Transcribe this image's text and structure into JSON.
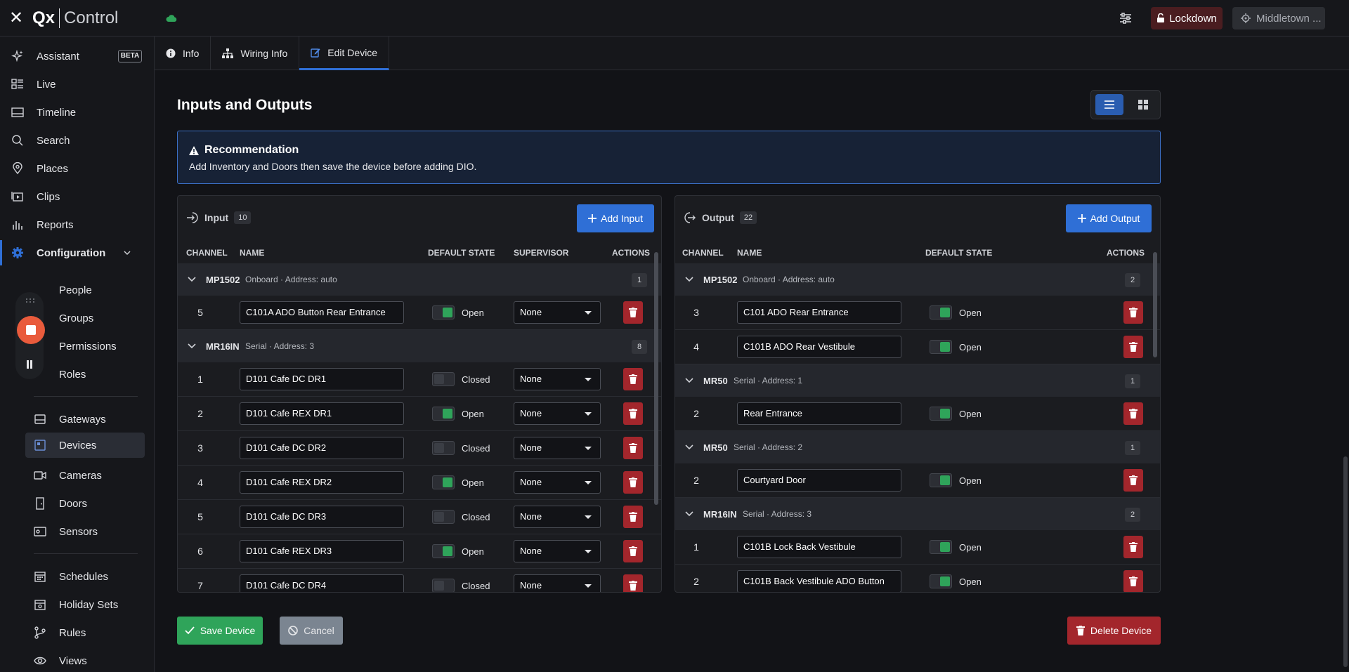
{
  "app": {
    "logo_brand": "Qx",
    "logo_product": "Control"
  },
  "header": {
    "lockdown_label": "Lockdown",
    "site_label": "Middletown ..."
  },
  "sidebar": {
    "assistant": "Assistant",
    "beta": "BETA",
    "live": "Live",
    "timeline": "Timeline",
    "search": "Search",
    "places": "Places",
    "clips": "Clips",
    "reports": "Reports",
    "configuration": "Configuration",
    "people": "People",
    "groups": "Groups",
    "permissions": "Permissions",
    "roles": "Roles",
    "gateways": "Gateways",
    "devices": "Devices",
    "cameras": "Cameras",
    "doors": "Doors",
    "sensors": "Sensors",
    "schedules": "Schedules",
    "holiday_sets": "Holiday Sets",
    "rules": "Rules",
    "views": "Views"
  },
  "tabs": {
    "info": "Info",
    "wiring": "Wiring Info",
    "edit": "Edit Device"
  },
  "page": {
    "title": "Inputs and Outputs",
    "banner_title": "Recommendation",
    "banner_text": "Add Inventory and Doors then save the device before adding DIO."
  },
  "input_panel": {
    "title": "Input",
    "count": "10",
    "add_label": "Add Input",
    "col_channel": "CHANNEL",
    "col_name": "NAME",
    "col_default": "DEFAULT STATE",
    "col_supervisor": "SUPERVISOR",
    "col_actions": "ACTIONS",
    "groups": [
      {
        "name": "MP1502",
        "meta": "Onboard · Address: auto",
        "count": "1",
        "rows": [
          {
            "channel": "5",
            "name": "C101A ADO Button Rear Entrance",
            "state": "Open",
            "supervisor": "None"
          }
        ]
      },
      {
        "name": "MR16IN",
        "meta": "Serial · Address: 3",
        "count": "8",
        "rows": [
          {
            "channel": "1",
            "name": "D101 Cafe DC DR1",
            "state": "Closed",
            "supervisor": "None"
          },
          {
            "channel": "2",
            "name": "D101 Cafe REX DR1",
            "state": "Open",
            "supervisor": "None"
          },
          {
            "channel": "3",
            "name": "D101 Cafe DC DR2",
            "state": "Closed",
            "supervisor": "None"
          },
          {
            "channel": "4",
            "name": "D101 Cafe REX DR2",
            "state": "Open",
            "supervisor": "None"
          },
          {
            "channel": "5",
            "name": "D101 Cafe DC DR3",
            "state": "Closed",
            "supervisor": "None"
          },
          {
            "channel": "6",
            "name": "D101 Cafe REX DR3",
            "state": "Open",
            "supervisor": "None"
          },
          {
            "channel": "7",
            "name": "D101 Cafe DC DR4",
            "state": "Closed",
            "supervisor": "None"
          }
        ]
      }
    ]
  },
  "output_panel": {
    "title": "Output",
    "count": "22",
    "add_label": "Add Output",
    "col_channel": "CHANNEL",
    "col_name": "NAME",
    "col_default": "DEFAULT STATE",
    "col_actions": "ACTIONS",
    "groups": [
      {
        "name": "MP1502",
        "meta": "Onboard · Address: auto",
        "count": "2",
        "rows": [
          {
            "channel": "3",
            "name": "C101 ADO Rear Entrance",
            "state": "Open"
          },
          {
            "channel": "4",
            "name": "C101B ADO Rear Vestibule",
            "state": "Open"
          }
        ]
      },
      {
        "name": "MR50",
        "meta": "Serial · Address: 1",
        "count": "1",
        "rows": [
          {
            "channel": "2",
            "name": "Rear Entrance",
            "state": "Open"
          }
        ]
      },
      {
        "name": "MR50",
        "meta": "Serial · Address: 2",
        "count": "1",
        "rows": [
          {
            "channel": "2",
            "name": "Courtyard Door",
            "state": "Open"
          }
        ]
      },
      {
        "name": "MR16IN",
        "meta": "Serial · Address: 3",
        "count": "2",
        "rows": [
          {
            "channel": "1",
            "name": "C101B Lock Back Vestibule",
            "state": "Open"
          },
          {
            "channel": "2",
            "name": "C101B Back Vestibule ADO Button",
            "state": "Open"
          }
        ]
      }
    ]
  },
  "footer": {
    "save": "Save Device",
    "cancel": "Cancel",
    "delete": "Delete Device"
  },
  "colors": {
    "accent": "#2f6fd6",
    "success": "#2fa45a",
    "danger": "#a3262c",
    "record": "#e95b3c"
  }
}
